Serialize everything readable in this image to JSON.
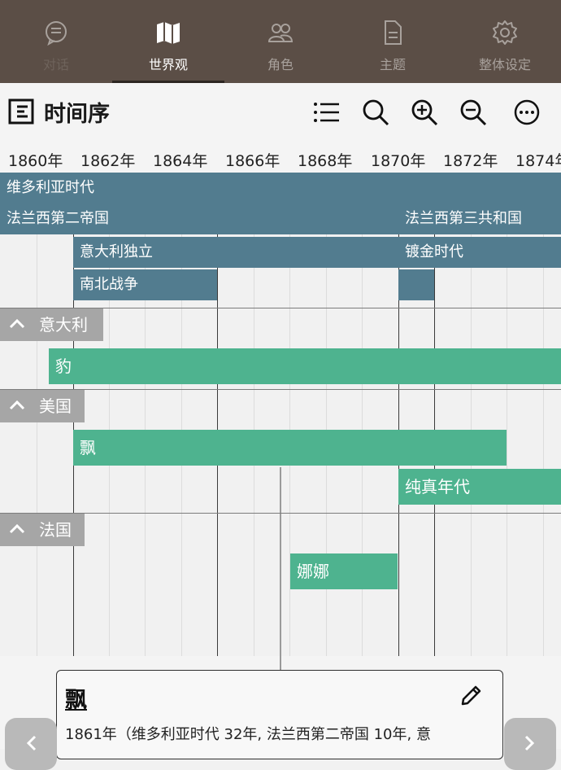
{
  "tabs": [
    {
      "label": "对话",
      "icon": "chat-bubble-icon",
      "active": false
    },
    {
      "label": "世界观",
      "icon": "map-icon",
      "active": true
    },
    {
      "label": "角色",
      "icon": "people-icon",
      "active": false
    },
    {
      "label": "主题",
      "icon": "document-icon",
      "active": false
    },
    {
      "label": "整体设定",
      "icon": "gear-icon",
      "active": false
    }
  ],
  "toolbar": {
    "title": "时间序",
    "title_icon": "timeline-icon",
    "tools": [
      "list-icon",
      "search-icon",
      "zoom-in-icon",
      "zoom-out-icon",
      "more-icon"
    ]
  },
  "ruler": {
    "years": [
      "1860年",
      "1862年",
      "1864年",
      "1866年",
      "1868年",
      "1870年",
      "1872年",
      "1874年"
    ]
  },
  "eras": [
    {
      "label": "维多利亚时代"
    },
    {
      "label": "法兰西第二帝国"
    },
    {
      "label": "法兰西第三共和国"
    },
    {
      "label": "意大利独立"
    },
    {
      "label": "镀金时代"
    },
    {
      "label": "南北战争"
    },
    {
      "label": ""
    }
  ],
  "groups": [
    {
      "label": "意大利",
      "works": [
        {
          "label": "豹"
        }
      ]
    },
    {
      "label": "美国",
      "works": [
        {
          "label": "飘"
        },
        {
          "label": "纯真年代"
        }
      ]
    },
    {
      "label": "法国",
      "works": [
        {
          "label": "娜娜"
        }
      ]
    }
  ],
  "detail": {
    "title": "飘",
    "text": "1861年（维多利亚时代 32年, 法兰西第二帝国 10年, 意",
    "edit_icon": "pencil-icon"
  },
  "nav": {
    "prev_icon": "chevron-left-icon",
    "next_icon": "chevron-right-icon"
  },
  "colors": {
    "tabbar": "#5b4e46",
    "era": "#527c8f",
    "work": "#4eb38f",
    "group_header": "#a6a6a6"
  }
}
